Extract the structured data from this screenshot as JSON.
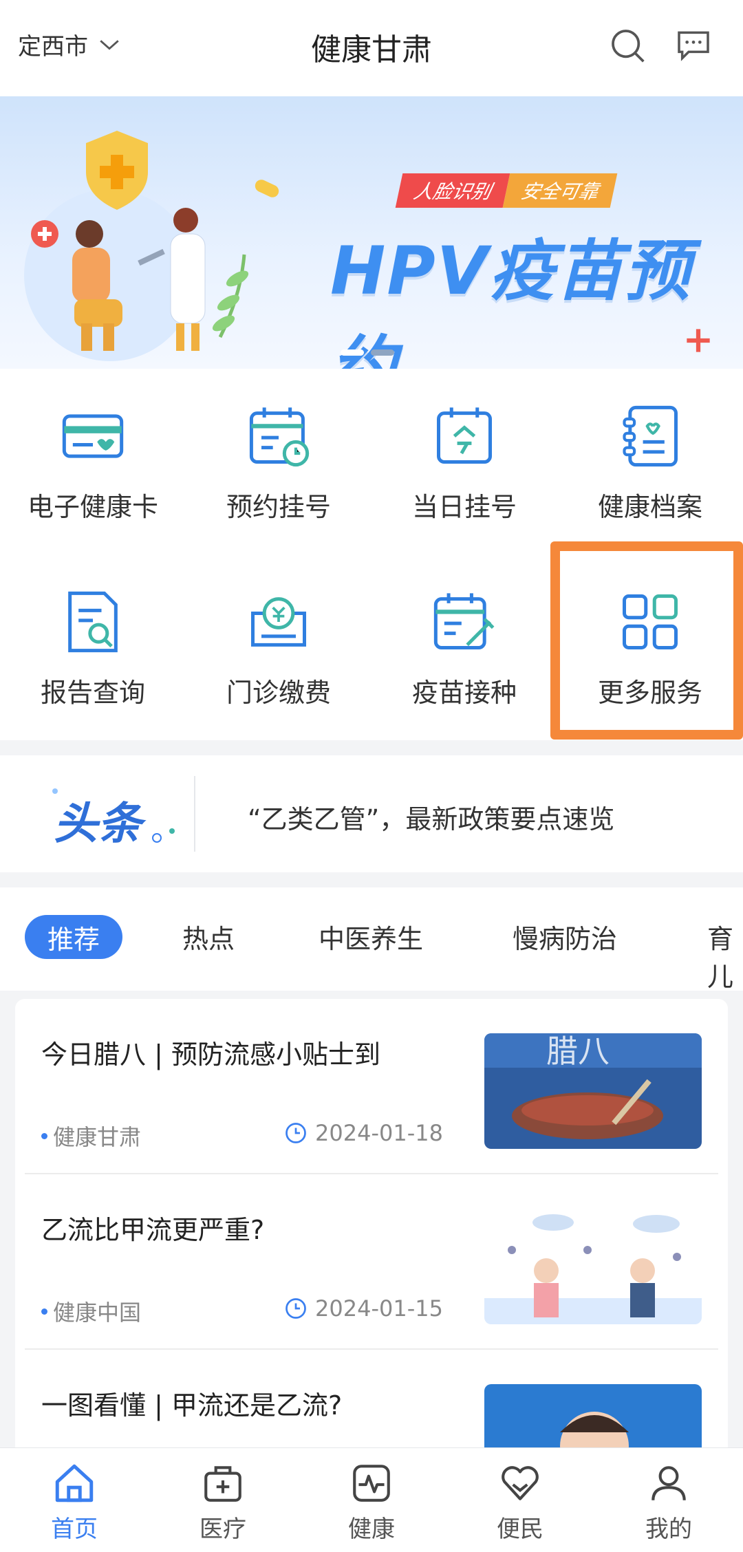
{
  "header": {
    "city": "定西市",
    "title": "健康甘肃"
  },
  "banner": {
    "tag1": "人脸识别",
    "tag2": "安全可靠",
    "title": "HPV疫苗预约"
  },
  "services": [
    {
      "label": "电子健康卡"
    },
    {
      "label": "预约挂号"
    },
    {
      "label": "当日挂号"
    },
    {
      "label": "健康档案"
    },
    {
      "label": "报告查询"
    },
    {
      "label": "门诊缴费"
    },
    {
      "label": "疫苗接种"
    },
    {
      "label": "更多服务"
    }
  ],
  "headline": {
    "logo_text": "头条",
    "text": "“乙类乙管”，最新政策要点速览"
  },
  "tabs": [
    "推荐",
    "热点",
    "中医养生",
    "慢病防治",
    "育儿"
  ],
  "news": [
    {
      "title": "今日腊八 | 预防流感小贴士到",
      "source": "健康甘肃",
      "date": "2024-01-18"
    },
    {
      "title": "乙流比甲流更严重?",
      "source": "健康中国",
      "date": "2024-01-15"
    },
    {
      "title": "一图看懂 | 甲流还是乙流?",
      "source": "",
      "date": ""
    }
  ],
  "nav": [
    {
      "label": "首页",
      "icon": "home-icon",
      "active": true
    },
    {
      "label": "医疗",
      "icon": "medical-kit-icon"
    },
    {
      "label": "健康",
      "icon": "heartbeat-icon"
    },
    {
      "label": "便民",
      "icon": "heart-hand-icon"
    },
    {
      "label": "我的",
      "icon": "user-icon"
    }
  ],
  "colors": {
    "accent": "#3a7ff0",
    "highlight": "#f5883a",
    "icon_teal": "#3fb6a8"
  }
}
